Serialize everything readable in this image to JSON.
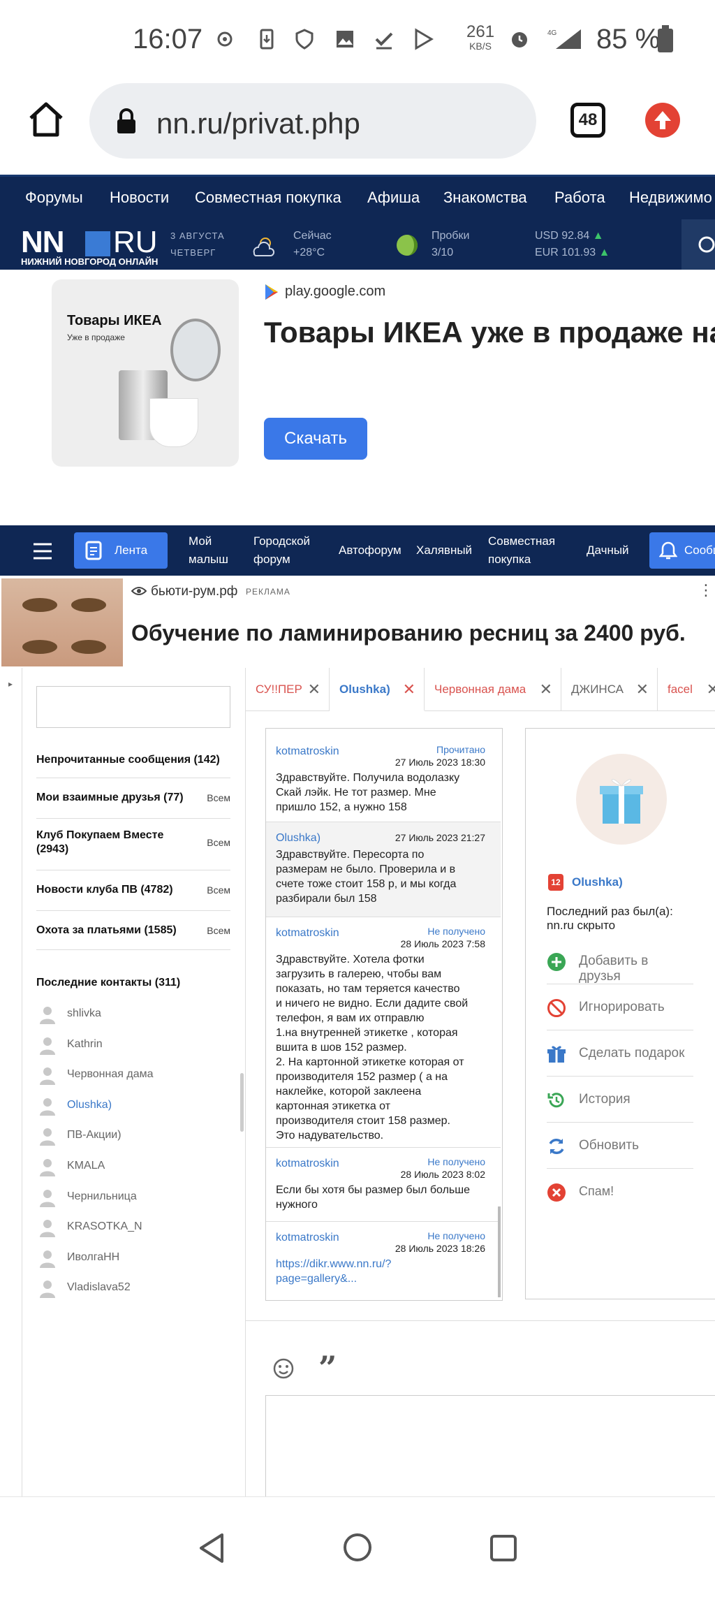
{
  "status_bar": {
    "time": "16:07",
    "speed_value": "261",
    "speed_unit": "KB/S",
    "battery": "85 %",
    "icons": [
      "settings-gear-icon",
      "sim-download-icon",
      "shield-icon",
      "image-icon",
      "check-icon",
      "play-store-icon",
      "alarm-icon",
      "signal-4g-icon",
      "battery-icon"
    ]
  },
  "browser": {
    "url": "nn.ru/privat.php",
    "tab_count": "48"
  },
  "site_nav": {
    "items": [
      "Форумы",
      "Новости",
      "Совместная покупка",
      "Афиша",
      "Знакомства",
      "Работа",
      "Недвижимо"
    ]
  },
  "header": {
    "logo_left": "NN",
    "logo_right": "RU",
    "logo_sub": "НИЖНИЙ НОВГОРОД ОНЛАЙН",
    "date_line1": "3 АВГУСТА",
    "date_line2": "ЧЕТВЕРГ",
    "weather_label": "Сейчас",
    "weather_value": "+28°C",
    "traffic_label": "Пробки",
    "traffic_value": "3/10",
    "usd": "USD 92.84",
    "eur": "EUR 101.93"
  },
  "ad1": {
    "img_title": "Товары ИКЕА",
    "img_subtitle": "Уже в продаже",
    "domain": "play.google.com",
    "title": "Товары ИКЕА уже в продаже на Я",
    "button": "Скачать"
  },
  "forum_nav": {
    "lenta": "Лента",
    "items": [
      {
        "l1": "Мой",
        "l2": "малыш"
      },
      {
        "l1": "Городской",
        "l2": "форум"
      },
      {
        "l1": "Автофорум",
        "l2": ""
      },
      {
        "l1": "Халявный",
        "l2": ""
      },
      {
        "l1": "Совместная",
        "l2": "покупка"
      },
      {
        "l1": "Дачный",
        "l2": ""
      }
    ],
    "notify": "Сообщ"
  },
  "ad2": {
    "domain": "бьюти-рум.рф",
    "label": "РЕКЛАМА",
    "title": "Обучение по ламинированию ресниц за 2400 руб."
  },
  "left_panel": {
    "rows": [
      {
        "title": "Непрочитанные сообщения (142)",
        "value": ""
      },
      {
        "title": "Мои взаимные друзья (77)",
        "value": "Всем"
      },
      {
        "title": "Клуб Покупаем Вместе",
        "title2": "(2943)",
        "value": "Всем"
      },
      {
        "title": "Новости клуба ПВ (4782)",
        "value": "Всем"
      },
      {
        "title": "Охота за платьями (1585)",
        "value": "Всем"
      }
    ],
    "contacts_header": "Последние контакты (311)",
    "contacts": [
      "shlivka",
      "Kathrin",
      "Червонная дама",
      "Olushka)",
      "ПВ-Акции)",
      "KMALA",
      "Чернильница",
      "KRASOTKA_N",
      "ИволгаНН",
      "Vladislava52"
    ]
  },
  "chat_tabs": [
    "СУ!!ПЕР",
    "Olushka)",
    "Червонная дама",
    "ДЖИНСА",
    "facel"
  ],
  "messages": [
    {
      "author": "kotmatroskin",
      "status": "Прочитано",
      "date": "27 Июль 2023 18:30",
      "lines": [
        "Здравствуйте. Получила водолазку",
        "Скай лэйк. Не тот размер. Мне",
        "пришло 152, а нужно 158"
      ]
    },
    {
      "author": "Olushka)",
      "status": "",
      "date": "27 Июль 2023 21:27",
      "lines": [
        "Здравствуйте. Пересорта по",
        "размерам не было. Проверила и в",
        "счете тоже стоит 158 р, и мы когда",
        "разбирали был 158"
      ]
    },
    {
      "author": "kotmatroskin",
      "status": "Не получено",
      "date": "28 Июль 2023 7:58",
      "lines": [
        "Здравствуйте. Хотела фотки",
        "загрузить в галерею, чтобы вам",
        "показать, но там теряется качество",
        "и ничего не видно. Если дадите свой",
        "телефон, я вам их отправлю",
        "1.на внутренней этикетке , которая",
        "вшита в шов 152 размер.",
        "2. На картонной этикетке которая от",
        "производителя 152 размер ( а на",
        "наклейке, которой заклеена",
        "картонная этикетка от",
        "производителя стоит 158 размер.",
        "Это надувательство."
      ]
    },
    {
      "author": "kotmatroskin",
      "status": "Не получено",
      "date": "28 Июль 2023 8:02",
      "lines": [
        "Если бы хотя бы размер был больше",
        "нужного"
      ]
    },
    {
      "author": "kotmatroskin",
      "status": "Не получено",
      "date": "28 Июль 2023 18:26",
      "lines": [
        "https://dikr.www.nn.ru/?",
        "page=gallery&..."
      ]
    }
  ],
  "profile": {
    "badge": "12",
    "name": "Olushka)",
    "last_seen_label": "Последний раз был(а):",
    "last_seen_value": "nn.ru скрыто",
    "actions": [
      {
        "label": "Добавить в друзья",
        "icon": "add-friend-icon",
        "color": "#3aa655"
      },
      {
        "label": "Игнорировать",
        "icon": "ignore-icon",
        "color": "#e34234"
      },
      {
        "label": "Сделать подарок",
        "icon": "gift-icon",
        "color": "#3a78c8"
      },
      {
        "label": "История",
        "icon": "history-icon",
        "color": "#3aa655"
      },
      {
        "label": "Обновить",
        "icon": "refresh-icon",
        "color": "#3a78c8"
      },
      {
        "label": "Спам!",
        "icon": "spam-icon",
        "color": "#e34234"
      }
    ]
  },
  "colors": {
    "nav_bg": "#0f2754",
    "accent": "#3a78e8",
    "link": "#3a78c8",
    "red": "#e34234"
  }
}
